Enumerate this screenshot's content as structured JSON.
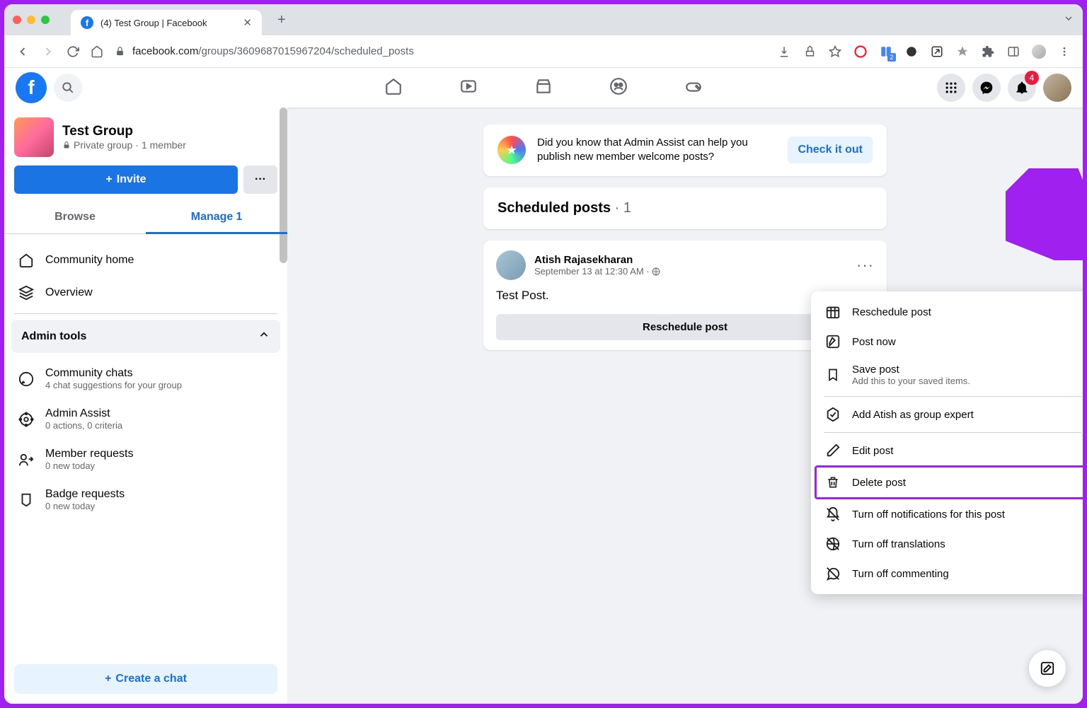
{
  "browser": {
    "tab_title": "(4) Test Group | Facebook",
    "url_host": "facebook.com",
    "url_path": "/groups/3609687015967204/scheduled_posts",
    "ext_badge": "2"
  },
  "fb_header": {
    "notif_count": "4"
  },
  "group": {
    "name": "Test Group",
    "privacy": "Private group",
    "members": "1 member",
    "invite_label": "Invite"
  },
  "tabs": {
    "browse": "Browse",
    "manage": "Manage",
    "manage_count": "1"
  },
  "nav": {
    "community_home": "Community home",
    "overview": "Overview",
    "admin_tools": "Admin tools",
    "community_chats": "Community chats",
    "community_chats_sub": "4 chat suggestions for your group",
    "admin_assist": "Admin Assist",
    "admin_assist_sub": "0 actions, 0 criteria",
    "member_requests": "Member requests",
    "member_requests_sub": "0 new today",
    "badge_requests": "Badge requests",
    "badge_requests_sub": "0 new today",
    "create_chat": "Create a chat"
  },
  "banner": {
    "text": "Did you know that Admin Assist can help you publish new member welcome posts?",
    "button": "Check it out"
  },
  "scheduled": {
    "title": "Scheduled posts",
    "count": "1"
  },
  "post": {
    "author": "Atish Rajasekharan",
    "time": "September 13 at 12:30 AM",
    "body": "Test Post.",
    "reschedule_label": "Reschedule post"
  },
  "menu": {
    "reschedule": "Reschedule post",
    "post_now": "Post now",
    "save": "Save post",
    "save_sub": "Add this to your saved items.",
    "expert": "Add Atish as group expert",
    "edit": "Edit post",
    "delete": "Delete post",
    "notif_off": "Turn off notifications for this post",
    "trans_off": "Turn off translations",
    "comment_off": "Turn off commenting"
  }
}
